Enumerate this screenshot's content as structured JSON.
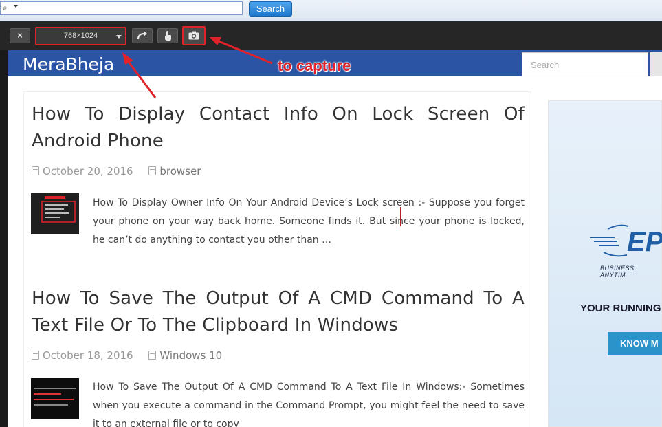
{
  "browser": {
    "search_button_label": "Search"
  },
  "toolbar": {
    "close_label": "×",
    "device_size": "768×1024"
  },
  "site": {
    "logo": "MeraBheja",
    "search_placeholder": "Search"
  },
  "posts": [
    {
      "title": "How To Display Contact Info On Lock Screen Of Android Phone",
      "date": "October 20, 2016",
      "category": "browser",
      "excerpt": "How To Display Owner Info On Your Android Device’s Lock screen :- Suppose you forget your phone on your way back home. Someone finds it. But since your phone is locked, he can’t do anything to contact you other than …"
    },
    {
      "title": "How To Save The Output Of A CMD Command To A Text File Or To The Clipboard In Windows",
      "date": "October 18, 2016",
      "category": "Windows 10",
      "excerpt": "How To Save The Output Of A CMD Command To A Text File In Windows:- Sometimes when you execute a command in the Command Prompt, you might feel the need to save it to an external file or to copy"
    }
  ],
  "ad": {
    "logo_text": "EP",
    "tagline": "BUSINESS. ANYTIM",
    "headline": "YOUR RUNNING",
    "button": "KNOW M"
  },
  "annotation": {
    "text": "to capture",
    "color": "#e0232a"
  },
  "icons": {
    "search": "magnifier-icon",
    "rotate": "rotate-icon",
    "touch": "touch-icon",
    "screenshot": "camera-icon"
  }
}
